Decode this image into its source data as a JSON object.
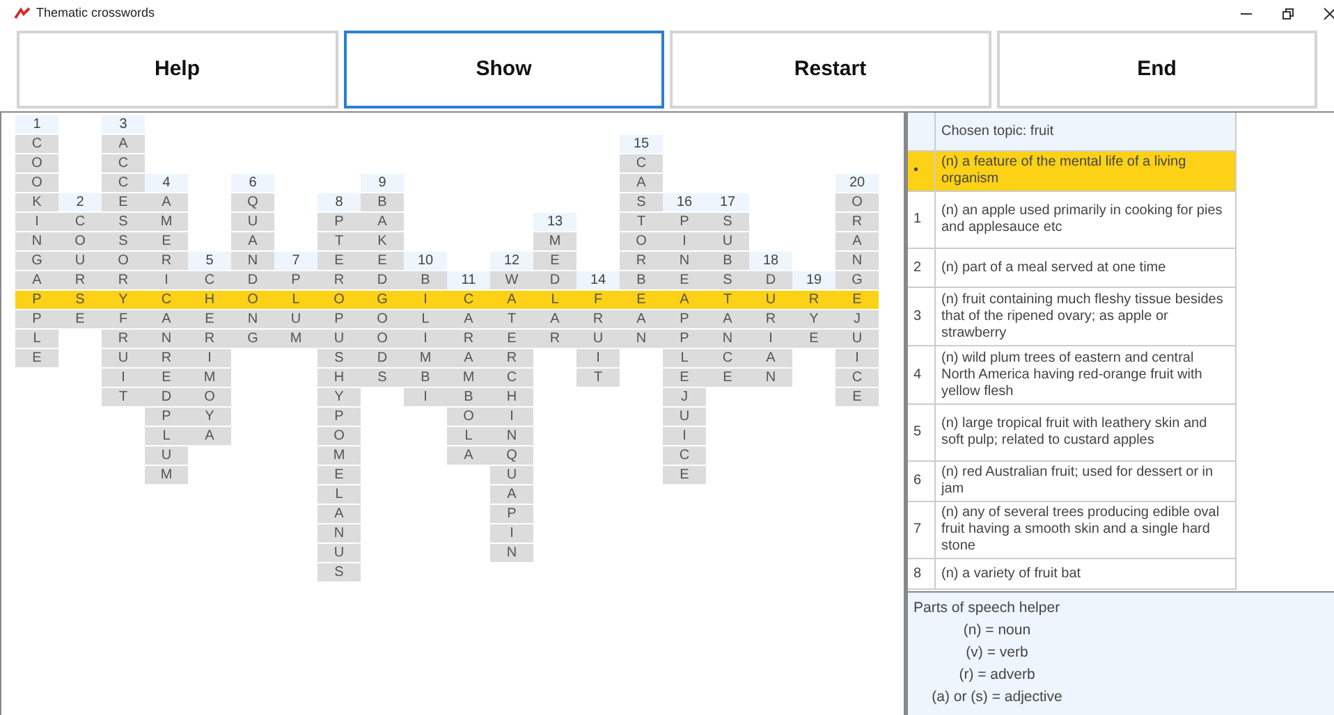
{
  "window": {
    "title": "Thematic crosswords"
  },
  "buttons": [
    {
      "label": "Help",
      "selected": false
    },
    {
      "label": "Show",
      "selected": true
    },
    {
      "label": "Restart",
      "selected": false
    },
    {
      "label": "End",
      "selected": false
    }
  ],
  "grid": {
    "columns": [
      {
        "number": "1",
        "before": [
          "C",
          "O",
          "O",
          "K",
          "I",
          "N",
          "G",
          "A"
        ],
        "key": "P",
        "after": [
          "P",
          "L",
          "E"
        ]
      },
      {
        "number": "2",
        "before": [
          "C",
          "O",
          "U",
          "R"
        ],
        "key": "S",
        "after": [
          "E"
        ]
      },
      {
        "number": "3",
        "before": [
          "A",
          "C",
          "C",
          "E",
          "S",
          "S",
          "O",
          "R"
        ],
        "key": "Y",
        "after": [
          "F",
          "R",
          "U",
          "I",
          "T"
        ]
      },
      {
        "number": "4",
        "before": [
          "A",
          "M",
          "E",
          "R",
          "I"
        ],
        "key": "C",
        "after": [
          "A",
          "N",
          "R",
          "E",
          "D",
          "P",
          "L",
          "U",
          "M"
        ]
      },
      {
        "number": "5",
        "before": [
          "C"
        ],
        "key": "H",
        "after": [
          "E",
          "R",
          "I",
          "M",
          "O",
          "Y",
          "A"
        ]
      },
      {
        "number": "6",
        "before": [
          "Q",
          "U",
          "A",
          "N",
          "D"
        ],
        "key": "O",
        "after": [
          "N",
          "G"
        ]
      },
      {
        "number": "7",
        "before": [
          "P"
        ],
        "key": "L",
        "after": [
          "U",
          "M"
        ]
      },
      {
        "number": "8",
        "before": [
          "P",
          "T",
          "E",
          "R"
        ],
        "key": "O",
        "after": [
          "P",
          "U",
          "S",
          "H",
          "Y",
          "P",
          "O",
          "M",
          "E",
          "L",
          "A",
          "N",
          "U",
          "S"
        ]
      },
      {
        "number": "9",
        "before": [
          "B",
          "A",
          "K",
          "E",
          "D"
        ],
        "key": "G",
        "after": [
          "O",
          "O",
          "D",
          "S"
        ]
      },
      {
        "number": "10",
        "before": [
          "B"
        ],
        "key": "I",
        "after": [
          "L",
          "I",
          "M",
          "B",
          "I"
        ]
      },
      {
        "number": "11",
        "key": "C",
        "after": [
          "A",
          "R",
          "A",
          "M",
          "B",
          "O",
          "L",
          "A"
        ]
      },
      {
        "number": "12",
        "before": [
          "W"
        ],
        "key": "A",
        "after": [
          "T",
          "E",
          "R",
          "C",
          "H",
          "I",
          "N",
          "Q",
          "U",
          "A",
          "P",
          "I",
          "N"
        ]
      },
      {
        "number": "13",
        "before": [
          "M",
          "E",
          "D"
        ],
        "key": "L",
        "after": [
          "A",
          "R"
        ]
      },
      {
        "number": "14",
        "key": "F",
        "after": [
          "R",
          "U",
          "I",
          "T"
        ]
      },
      {
        "number": "15",
        "before": [
          "C",
          "A",
          "S",
          "T",
          "O",
          "R",
          "B"
        ],
        "key": "E",
        "after": [
          "A",
          "N"
        ]
      },
      {
        "number": "16",
        "before": [
          "P",
          "I",
          "N",
          "E"
        ],
        "key": "A",
        "after": [
          "P",
          "P",
          "L",
          "E",
          "J",
          "U",
          "I",
          "C",
          "E"
        ]
      },
      {
        "number": "17",
        "before": [
          "S",
          "U",
          "B",
          "S"
        ],
        "key": "T",
        "after": [
          "A",
          "N",
          "C",
          "E"
        ]
      },
      {
        "number": "18",
        "before": [
          "D"
        ],
        "key": "U",
        "after": [
          "R",
          "I",
          "A",
          "N"
        ]
      },
      {
        "number": "19",
        "key": "R",
        "after": [
          "Y",
          "E"
        ]
      },
      {
        "number": "20",
        "before": [
          "O",
          "R",
          "A",
          "N",
          "G"
        ],
        "key": "E",
        "after": [
          "J",
          "U",
          "I",
          "C",
          "E"
        ]
      }
    ]
  },
  "clues": {
    "header": "Chosen topic: fruit",
    "rows": [
      {
        "index": "•",
        "text": "(n) a feature of the mental life of a living organism",
        "selected": true
      },
      {
        "index": "1",
        "text": "(n) an apple used primarily in cooking for pies and applesauce etc",
        "selected": false
      },
      {
        "index": "2",
        "text": "(n) part of a meal served at one time",
        "selected": false
      },
      {
        "index": "3",
        "text": "(n) fruit containing much fleshy tissue besides that of the ripened ovary; as apple or strawberry",
        "selected": false
      },
      {
        "index": "4",
        "text": "(n) wild plum trees of eastern and central North America having red-orange fruit with yellow flesh",
        "selected": false
      },
      {
        "index": "5",
        "text": "(n) large tropical fruit with leathery skin and soft pulp; related to custard apples",
        "selected": false
      },
      {
        "index": "6",
        "text": "(n) red Australian fruit; used for dessert or in jam",
        "selected": false
      },
      {
        "index": "7",
        "text": "(n) any of several trees producing edible oval fruit having a smooth skin and a single hard stone",
        "selected": false
      },
      {
        "index": "8",
        "text": "(n) a variety of fruit bat",
        "selected": false
      }
    ]
  },
  "helper": {
    "title": "Parts of speech helper",
    "lines": [
      "(n) = noun",
      "(v) = verb",
      "(r) = adverb",
      "(a) or (s) = adjective"
    ]
  }
}
